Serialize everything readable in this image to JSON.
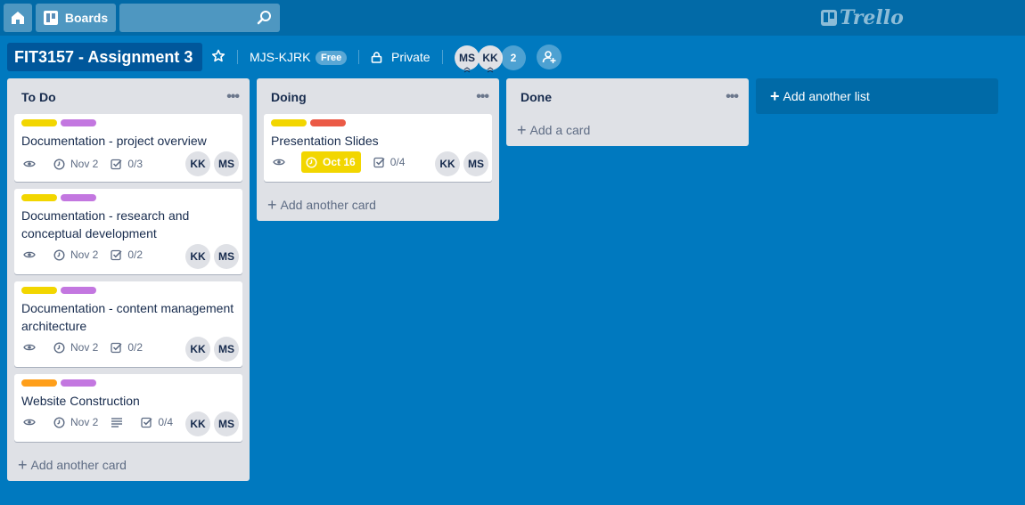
{
  "header": {
    "boards_label": "Boards",
    "search_placeholder": "",
    "logo_text": "Trello"
  },
  "board": {
    "title": "FIT3157 - Assignment 3",
    "team": "MJS-KJRK",
    "team_badge": "Free",
    "visibility": "Private",
    "members": [
      "MS",
      "KK"
    ],
    "extra_members": "2"
  },
  "lists": [
    {
      "title": "To Do",
      "cards": [
        {
          "labels": [
            "#f2d600",
            "#c377e0"
          ],
          "title": "Documentation - project overview",
          "due": "Nov 2",
          "checklist": "0/3",
          "members": [
            "KK",
            "MS"
          ]
        },
        {
          "labels": [
            "#f2d600",
            "#c377e0"
          ],
          "title": "Documentation - research and conceptual development",
          "due": "Nov 2",
          "checklist": "0/2",
          "members": [
            "KK",
            "MS"
          ]
        },
        {
          "labels": [
            "#f2d600",
            "#c377e0"
          ],
          "title": "Documentation - content management architecture",
          "due": "Nov 2",
          "checklist": "0/2",
          "members": [
            "KK",
            "MS"
          ]
        },
        {
          "labels": [
            "#ff9f1a",
            "#c377e0"
          ],
          "title": "Website Construction",
          "due": "Nov 2",
          "checklist": "0/4",
          "members": [
            "KK",
            "MS"
          ]
        }
      ],
      "add_label": "Add another card"
    },
    {
      "title": "Doing",
      "cards": [
        {
          "labels": [
            "#f2d600",
            "#eb5a46"
          ],
          "title": "Presentation Slides",
          "due": "Oct 16",
          "checklist": "0/4",
          "members": [
            "KK",
            "MS"
          ]
        }
      ],
      "add_label": "Add another card"
    },
    {
      "title": "Done",
      "cards": [],
      "add_label": "Add a card"
    }
  ],
  "add_list_label": "Add another list",
  "colors": {
    "board_bg": "#0079bf",
    "header_bg": "#026aa7",
    "list_bg": "#dfe1e6",
    "due_soon": "#f2d600"
  }
}
